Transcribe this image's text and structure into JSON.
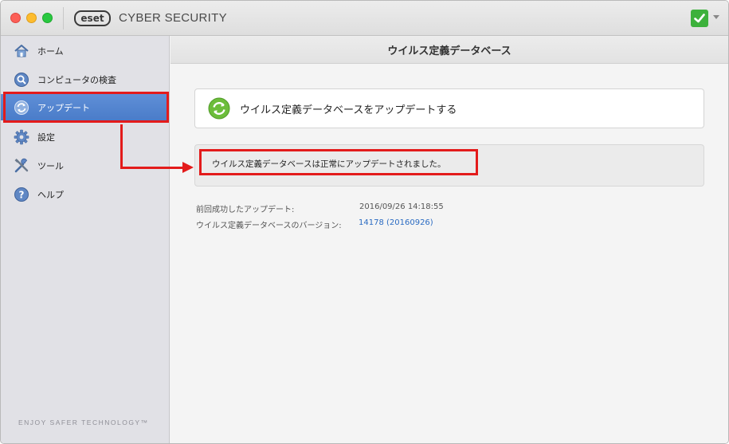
{
  "titlebar": {
    "logo_text": "eset",
    "app_title": "CYBER SECURITY",
    "status_icon": "green-check-icon",
    "status_color": "#3db13c"
  },
  "sidebar": {
    "items": [
      {
        "label": "ホーム",
        "icon": "home-icon"
      },
      {
        "label": "コンピュータの検査",
        "icon": "search-icon"
      },
      {
        "label": "アップデート",
        "icon": "update-icon",
        "active": true
      },
      {
        "label": "設定",
        "icon": "gear-icon"
      },
      {
        "label": "ツール",
        "icon": "tools-icon"
      },
      {
        "label": "ヘルプ",
        "icon": "help-icon"
      }
    ],
    "tagline": "ENJOY SAFER TECHNOLOGY™",
    "active_color": "#4a7cc9"
  },
  "content": {
    "header_title": "ウイルス定義データベース",
    "update_button_label": "ウイルス定義データベースをアップデートする",
    "status_message": "ウイルス定義データベースは正常にアップデートされました。",
    "info": {
      "last_update_label": "前回成功したアップデート:",
      "last_update_value": "2016/09/26 14:18:55",
      "version_label": "ウイルス定義データベースのバージョン:",
      "version_value": "14178 (20160926)",
      "version_color": "#2a6bc2"
    }
  },
  "annotation_color": "#e31b1b"
}
